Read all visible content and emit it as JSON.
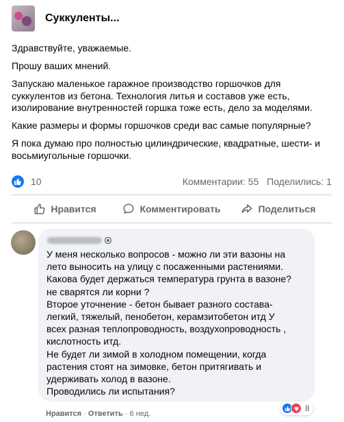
{
  "group": {
    "name": "Суккуленты..."
  },
  "post": {
    "paragraphs": [
      "Здравствуйте, уважаемые.",
      "Прошу ваших мнений.",
      "Запускаю маленькое гаражное производство горшочков для суккулентов из бетона. Технология литья и составов уже есть, изолирование внутренностей горшка тоже есть, дело за моделями.",
      "Какие размеры и формы горшочков среди вас самые популярные?",
      "Я пока думаю про полностью цилиндрические, квадратные, шести- и восьмиугольные горшочки."
    ]
  },
  "stats": {
    "likes": "10",
    "comments": "Комментарии: 55",
    "shares": "Поделились: 1"
  },
  "actions": {
    "like": "Нравится",
    "comment": "Комментировать",
    "share": "Поделиться"
  },
  "comment": {
    "lines": [
      "У меня несколько вопросов - можно ли эти вазоны на",
      "лето выносить на улицу с посаженными растениями.",
      "Какова будет держаться температура грунта в вазоне?",
      "не сварятся ли корни ?",
      "Второе уточнение - бетон бывает разного состава-",
      "легкий, тяжелый, пенобетон, керамзитобетон итд У",
      "всех разная теплопроводность, воздухопроводность ,",
      "кислотность итд.",
      "Не будет ли зимой в холодном помещении, когда",
      "растения стоят на зимовке, бетон притягивать и",
      "удерживать холод в вазоне.",
      "Проводились ли испытания?"
    ],
    "reaction_count": "8",
    "like_label": "Нравится",
    "reply_label": "Ответить",
    "time": "6 нед."
  }
}
